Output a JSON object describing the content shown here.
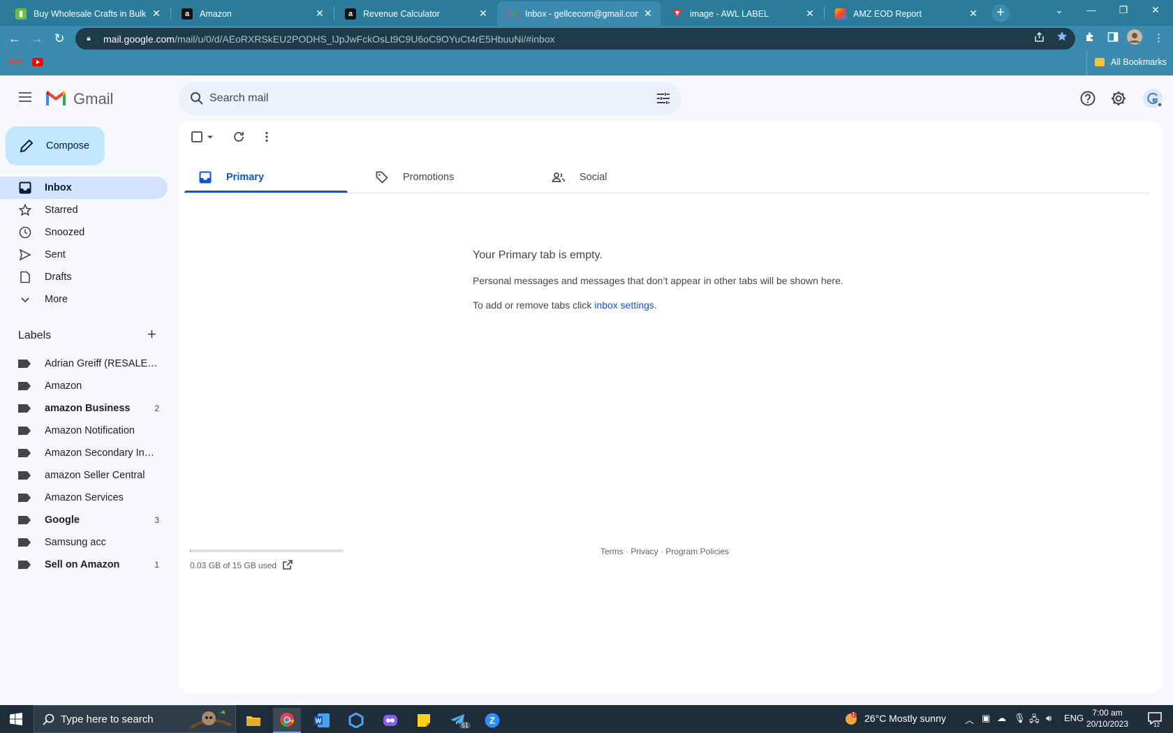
{
  "browser": {
    "tabs": [
      {
        "title": "Buy Wholesale Crafts in Bulk, C",
        "favicon": "leaf-favicon",
        "active": false
      },
      {
        "title": "Amazon",
        "favicon": "amazon-favicon",
        "active": false
      },
      {
        "title": "Revenue Calculator",
        "favicon": "amazon-favicon",
        "active": false
      },
      {
        "title": "Inbox - gellcecom@gmail.com",
        "favicon": "gmail-favicon",
        "active": true
      },
      {
        "title": "image - AWL LABEL",
        "favicon": "red-v-favicon",
        "active": false
      },
      {
        "title": "AMZ EOD Report",
        "favicon": "colorful-favicon",
        "active": false
      }
    ],
    "url_host": "mail.google.com",
    "url_path": "/mail/u/0/d/AEoRXRSkEU2PODHS_lJpJwFckOsLt9C9U6oC9OYuCt4rE5HbuuNi/#inbox",
    "bookmarks_label": "All Bookmarks",
    "accent": "#3b8ab0"
  },
  "gmail": {
    "brand": "Gmail",
    "search_placeholder": "Search mail",
    "compose_label": "Compose",
    "nav": [
      {
        "label": "Inbox",
        "icon": "inbox-icon",
        "active": true
      },
      {
        "label": "Starred",
        "icon": "star-icon",
        "active": false
      },
      {
        "label": "Snoozed",
        "icon": "clock-icon",
        "active": false
      },
      {
        "label": "Sent",
        "icon": "send-icon",
        "active": false
      },
      {
        "label": "Drafts",
        "icon": "draft-icon",
        "active": false
      },
      {
        "label": "More",
        "icon": "chevron-down-icon",
        "active": false
      }
    ],
    "labels_title": "Labels",
    "labels": [
      {
        "name": "Adrian Greiff (RESALE C...",
        "count": "",
        "bold": false
      },
      {
        "name": "Amazon",
        "count": "",
        "bold": false
      },
      {
        "name": "amazon Business",
        "count": "2",
        "bold": true
      },
      {
        "name": "Amazon Notification",
        "count": "",
        "bold": false
      },
      {
        "name": "Amazon Secondary Invit...",
        "count": "",
        "bold": false
      },
      {
        "name": "amazon Seller Central",
        "count": "",
        "bold": false
      },
      {
        "name": "Amazon Services",
        "count": "",
        "bold": false
      },
      {
        "name": "Google",
        "count": "3",
        "bold": true
      },
      {
        "name": "Samsung acc",
        "count": "",
        "bold": false
      },
      {
        "name": "Sell on Amazon",
        "count": "1",
        "bold": true
      }
    ],
    "category_tabs": [
      {
        "label": "Primary",
        "icon": "inbox-tab-icon",
        "active": true
      },
      {
        "label": "Promotions",
        "icon": "tag-icon",
        "active": false
      },
      {
        "label": "Social",
        "icon": "people-icon",
        "active": false
      }
    ],
    "empty": {
      "title": "Your Primary tab is empty.",
      "description": "Personal messages and messages that don’t appear in other tabs will be shown here.",
      "settings_prefix": "To add or remove tabs click ",
      "settings_link": "inbox settings",
      "settings_suffix": "."
    },
    "storage": {
      "text": "0.03 GB of 15 GB used",
      "used_fraction": 0.002
    },
    "footer": "Terms · Privacy · Program Policies",
    "active_color": "#0b57d0",
    "compose_color": "#c2e7ff"
  },
  "taskbar": {
    "search_placeholder": "Type here to search",
    "telegram_badge": "51",
    "weather": "26°C  Mostly sunny",
    "weather_badge": "1",
    "language": "ENG",
    "time": "7:00 am",
    "date": "20/10/2023",
    "notifications": "12"
  }
}
